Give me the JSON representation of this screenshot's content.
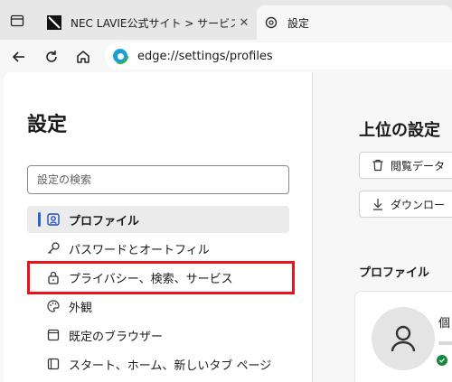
{
  "tabs": [
    {
      "title": "NEC LAVIE公式サイト > サービス&サ",
      "close_label": "✕",
      "favicon": "nec-favicon"
    },
    {
      "title": "設定",
      "favicon": "gear-icon"
    }
  ],
  "address": {
    "url": "edge://settings/profiles"
  },
  "sidebar": {
    "title": "設定",
    "search_placeholder": "設定の検索",
    "items": [
      {
        "label": "プロファイル",
        "icon": "profile-icon"
      },
      {
        "label": "パスワードとオートフィル",
        "icon": "key-icon"
      },
      {
        "label": "プライバシー、検索、サービス",
        "icon": "lock-icon"
      },
      {
        "label": "外観",
        "icon": "palette-icon"
      },
      {
        "label": "既定のブラウザー",
        "icon": "browser-icon"
      },
      {
        "label": "スタート、ホーム、新しいタブ ページ",
        "icon": "home-page-icon"
      }
    ]
  },
  "main": {
    "title": "上位の設定",
    "buttons": [
      {
        "label": "閲覧データ",
        "icon": "trash-icon"
      },
      {
        "label": "ダウンロー",
        "icon": "download-icon"
      }
    ],
    "profile_heading": "プロファイル",
    "profile_name": "個"
  },
  "colors": {
    "accent": "#2a63c7",
    "highlight": "#e8121b",
    "presence": "#15883e"
  }
}
